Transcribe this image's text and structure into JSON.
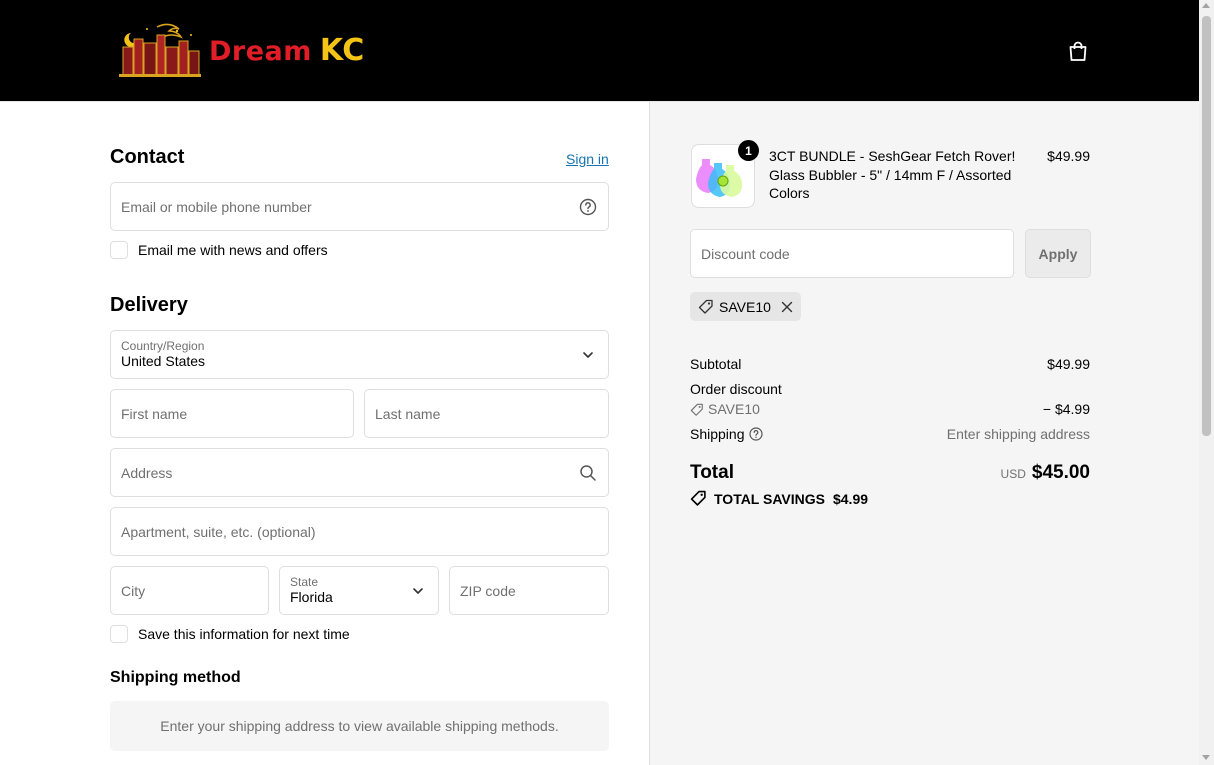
{
  "header": {
    "logo_dream": "Dream",
    "logo_kc": "KC",
    "cart_icon": "shopping-bag-icon"
  },
  "contact": {
    "title": "Contact",
    "sign_in": "Sign in",
    "email_placeholder": "Email or mobile phone number",
    "help_icon": "question-circle-icon",
    "newsletter_label": "Email me with news and offers"
  },
  "delivery": {
    "title": "Delivery",
    "country_label": "Country/Region",
    "country_value": "United States",
    "first_name_placeholder": "First name",
    "last_name_placeholder": "Last name",
    "address_placeholder": "Address",
    "apartment_placeholder": "Apartment, suite, etc. (optional)",
    "city_placeholder": "City",
    "state_label": "State",
    "state_value": "Florida",
    "zip_placeholder": "ZIP code",
    "save_info_label": "Save this information for next time"
  },
  "shipping_method": {
    "title": "Shipping method",
    "message": "Enter your shipping address to view available shipping methods."
  },
  "summary": {
    "product": {
      "quantity": "1",
      "name": "3CT BUNDLE - SeshGear Fetch Rover! Glass Bubbler - 5\" / 14mm F / Assorted Colors",
      "price": "$49.99"
    },
    "discount_placeholder": "Discount code",
    "apply_label": "Apply",
    "applied_code": "SAVE10",
    "subtotal_label": "Subtotal",
    "subtotal_value": "$49.99",
    "order_discount_label": "Order discount",
    "order_discount_code": "SAVE10",
    "order_discount_value": "− $4.99",
    "shipping_label": "Shipping",
    "shipping_value": "Enter shipping address",
    "total_label": "Total",
    "total_currency": "USD",
    "total_value": "$45.00",
    "savings_label": "TOTAL SAVINGS",
    "savings_value": "$4.99"
  }
}
